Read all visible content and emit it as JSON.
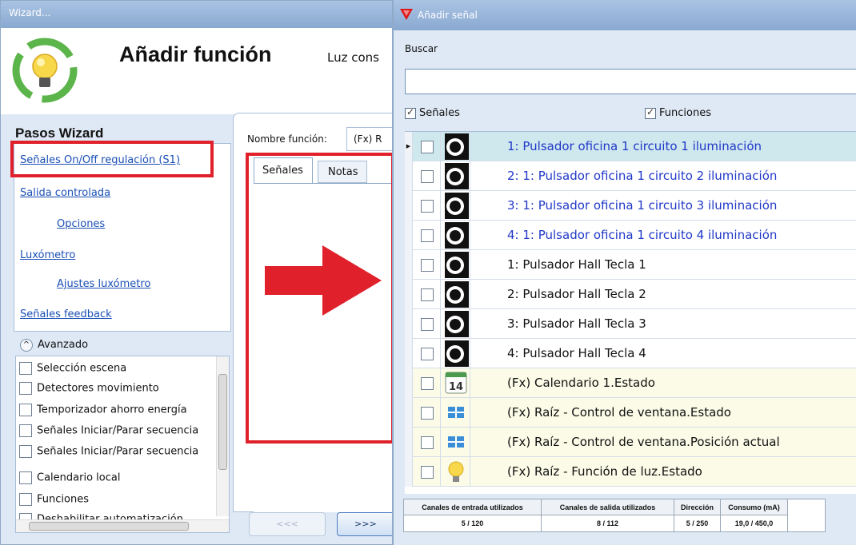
{
  "wizard": {
    "window_title": "Wizard...",
    "heading": "Añadir función",
    "subtitle": "Luz cons",
    "steps_title": "Pasos Wizard",
    "steps": [
      {
        "label": "Señales On/Off regulación (S1)",
        "indent": false
      },
      {
        "label": "Salida controlada",
        "indent": false
      },
      {
        "label": "Opciones",
        "indent": true
      },
      {
        "label": "Luxómetro",
        "indent": false
      },
      {
        "label": "Ajustes luxómetro",
        "indent": true
      },
      {
        "label": "Señales feedback",
        "indent": false
      }
    ],
    "advanced_label": "Avanzado",
    "advanced_items": [
      "Selección escena",
      "Detectores movimiento",
      "Temporizador ahorro energía",
      "Señales Iniciar/Parar secuencia",
      "Señales Iniciar/Parar secuencia",
      "Calendario local",
      "Funciones",
      "Deshabilitar automatización"
    ],
    "function_name_label": "Nombre función:",
    "function_name_value": "(Fx) R",
    "tabs": [
      "Señales",
      "Notas"
    ],
    "back_button": "<<<",
    "next_button": ">>>"
  },
  "add_signal": {
    "window_title": "Añadir señal",
    "search_label": "Buscar",
    "search_value": "",
    "filter_signals": "Señales",
    "filter_functions": "Funciones",
    "rows": [
      {
        "label": "1: Pulsador oficina 1 circuito 1 iluminación",
        "icon": "pushbutton-icon",
        "blue": true,
        "selected": true
      },
      {
        "label": "2: 1: Pulsador oficina 1 circuito 2 iluminación",
        "icon": "pushbutton-icon",
        "blue": true
      },
      {
        "label": "3: 1: Pulsador oficina 1 circuito 3 iluminación",
        "icon": "pushbutton-icon",
        "blue": true
      },
      {
        "label": "4: 1: Pulsador oficina 1 circuito 4 iluminación",
        "icon": "pushbutton-icon",
        "blue": true
      },
      {
        "label": "1: Pulsador Hall Tecla 1",
        "icon": "pushbutton-icon",
        "blue": false
      },
      {
        "label": "2: Pulsador Hall Tecla 2",
        "icon": "pushbutton-icon",
        "blue": false
      },
      {
        "label": "3: Pulsador Hall Tecla 3",
        "icon": "pushbutton-icon",
        "blue": false
      },
      {
        "label": "4: Pulsador Hall Tecla 4",
        "icon": "pushbutton-icon",
        "blue": false
      },
      {
        "label": "(Fx) Calendario 1.Estado",
        "icon": "calendar-icon",
        "blue": false,
        "fx": true,
        "icon_text": "14"
      },
      {
        "label": "(Fx) Raíz - Control de ventana.Estado",
        "icon": "window-icon",
        "blue": false,
        "fx": true
      },
      {
        "label": "(Fx) Raíz - Control de ventana.Posición actual",
        "icon": "window-icon",
        "blue": false,
        "fx": true
      },
      {
        "label": "(Fx) Raíz - Función de luz.Estado",
        "icon": "lightbulb-icon",
        "blue": false,
        "fx": true
      }
    ],
    "status": [
      {
        "header": "Canales de entrada utilizados",
        "value": "5 / 120"
      },
      {
        "header": "Canales de salida utilizados",
        "value": "8 / 112"
      },
      {
        "header": "Dirección",
        "value": "5 / 250"
      },
      {
        "header": "Consumo (mA)",
        "value": "19,0 / 450,0"
      }
    ]
  },
  "colors": {
    "highlight_red": "#e0202a",
    "link_blue": "#1a4fb5",
    "row_blue": "#2038c8",
    "selected_row": "#cfe8ee",
    "fx_row": "#fbfbe8"
  }
}
